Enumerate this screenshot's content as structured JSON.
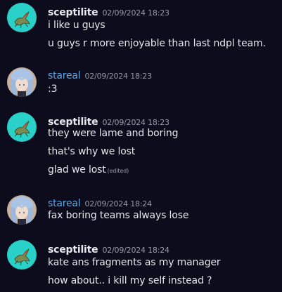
{
  "colors": {
    "background": "#0c0c1c",
    "user_sceptilite": "#e8e8ee",
    "user_stareal": "#5aa7e6",
    "text": "#e6e6ea",
    "timestamp": "#9a9aa6",
    "avatar_sceptilite_bg": "#2ad1c9"
  },
  "messages": [
    {
      "username": "sceptilite",
      "timestamp": "02/09/2024 18:23",
      "lines": [
        "i like u guys",
        "u guys r more enjoyable than last ndpl team."
      ]
    },
    {
      "username": "stareal",
      "timestamp": "02/09/2024 18:23",
      "lines": [
        ":3"
      ]
    },
    {
      "username": "sceptilite",
      "timestamp": "02/09/2024 18:23",
      "lines": [
        "they were lame and boring",
        "that's why we lost",
        "glad we lost"
      ],
      "edited_label": "(edited)"
    },
    {
      "username": "stareal",
      "timestamp": "02/09/2024 18:24",
      "lines": [
        "fax boring teams always lose"
      ]
    },
    {
      "username": "sceptilite",
      "timestamp": "02/09/2024 18:24",
      "lines": [
        "kate ans fragments as my manager",
        "how about.. i kill my self instead ?"
      ]
    }
  ]
}
